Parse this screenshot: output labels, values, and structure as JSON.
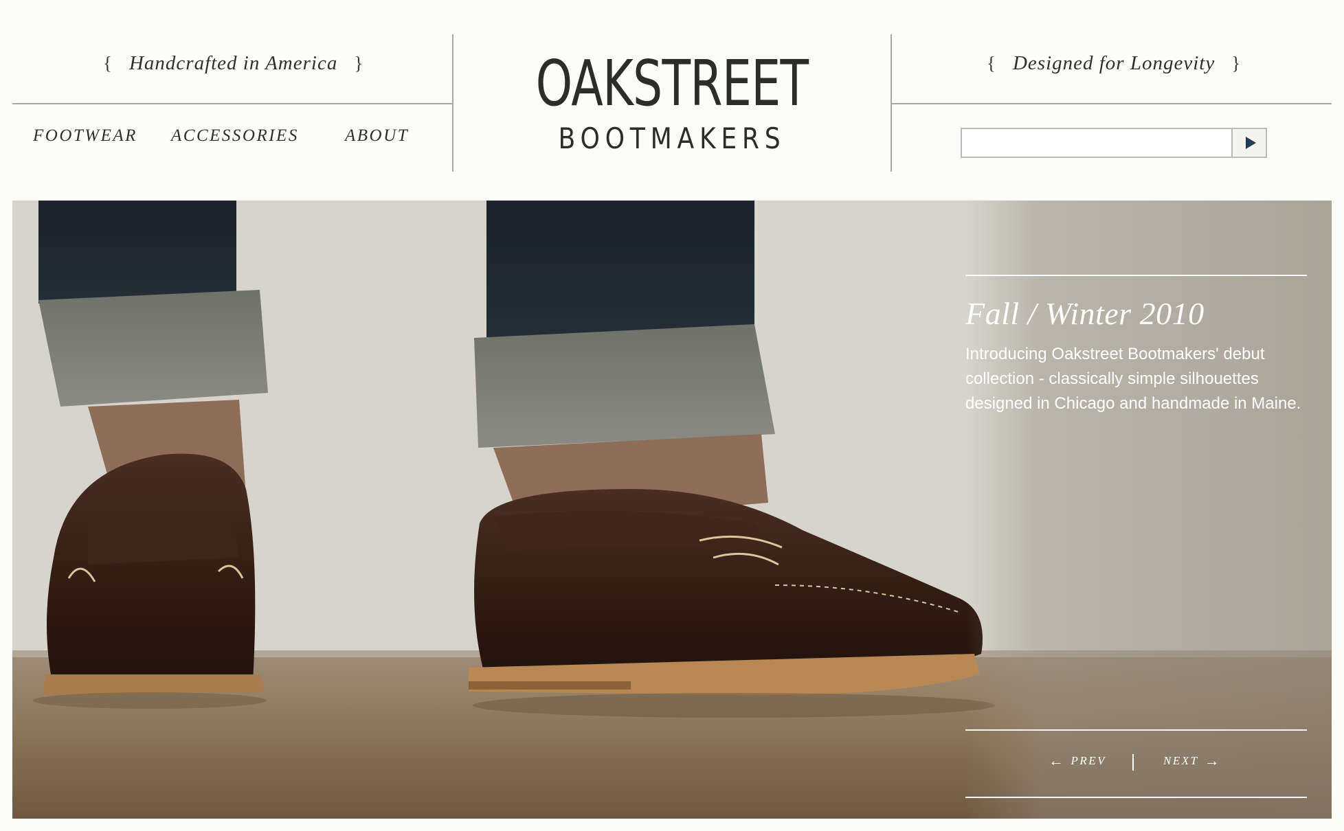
{
  "header": {
    "tagline_left": "Handcrafted in America",
    "tagline_right": "Designed for Longevity",
    "brace_open": "{",
    "brace_close": "}",
    "logo_main": "OAKSTREET",
    "logo_sub": "BOOTMAKERS",
    "nav": [
      {
        "label": "FOOTWEAR"
      },
      {
        "label": "ACCESSORIES"
      },
      {
        "label": "ABOUT"
      }
    ],
    "search": {
      "value": "",
      "placeholder": "",
      "button_icon": "play-triangle-icon"
    }
  },
  "hero": {
    "image_subject": "brown-penny-loafers-with-cuffed-denim",
    "slide_title": "Fall / Winter 2010",
    "slide_description": "Introducing Oakstreet Bootmakers' debut collection - classically simple silhouettes designed in Chicago and handmade in Maine.",
    "prev_label": "PREV",
    "next_label": "NEXT",
    "prev_icon": "←",
    "next_icon": "→"
  },
  "colors": {
    "background": "#fcfcf8",
    "text": "#2e2e2b",
    "rule": "#a9a9a3",
    "search_icon": "#253a57"
  }
}
